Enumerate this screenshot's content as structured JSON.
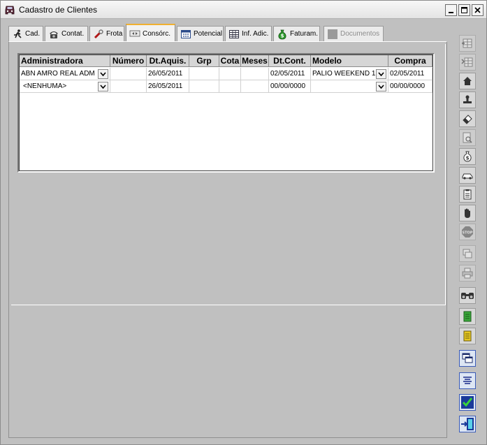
{
  "window": {
    "title": "Cadastro de Clientes"
  },
  "tabs": [
    {
      "label": "Cad.",
      "icon": "running-person-icon"
    },
    {
      "label": "Contat.",
      "icon": "telephone-icon"
    },
    {
      "label": "Frota",
      "icon": "wrench-icon"
    },
    {
      "label": "Consórc.",
      "icon": "consortium-icon",
      "active": true
    },
    {
      "label": "Potencial",
      "icon": "calendar-icon"
    },
    {
      "label": "Inf. Adic.",
      "icon": "grid-icon"
    },
    {
      "label": "Faturam.",
      "icon": "money-bag-icon"
    },
    {
      "label": "Documentos",
      "icon": "document-icon",
      "disabled": true
    }
  ],
  "grid": {
    "columns": [
      "Administradora",
      "Número",
      "Dt.Aquis.",
      "Grp",
      "Cota",
      "Meses",
      "Dt.Cont.",
      "Modelo",
      "Compra"
    ],
    "rows": [
      {
        "administradora": "ABN AMRO REAL ADM",
        "numero": "",
        "dt_aquis": "26/05/2011",
        "grp": "",
        "cota": "",
        "meses": "",
        "dt_cont": "02/05/2011",
        "modelo": "PALIO WEEKEND 1",
        "compra": "02/05/2011"
      },
      {
        "administradora": "<NENHUMA>",
        "numero": "",
        "dt_aquis": "26/05/2011",
        "grp": "",
        "cota": "",
        "meses": "",
        "dt_cont": "00/00/0000",
        "modelo": "",
        "compra": "00/00/0000"
      }
    ]
  },
  "toolbar": [
    {
      "name": "add-row-icon",
      "enabled": false
    },
    {
      "name": "insert-row-icon",
      "enabled": false
    },
    {
      "name": "home-icon",
      "enabled": true
    },
    {
      "name": "stamp-icon",
      "enabled": true
    },
    {
      "name": "eraser-icon",
      "enabled": true
    },
    {
      "name": "search-document-icon",
      "enabled": false
    },
    {
      "name": "money-bag-icon",
      "enabled": true
    },
    {
      "name": "car-icon",
      "enabled": true
    },
    {
      "name": "clipboard-icon",
      "enabled": true
    },
    {
      "name": "hand-icon",
      "enabled": true
    },
    {
      "name": "stop-icon",
      "enabled": false
    },
    {
      "name": "copy-icon",
      "enabled": false
    },
    {
      "name": "print-icon",
      "enabled": false
    },
    {
      "name": "binoculars-icon",
      "enabled": true
    },
    {
      "name": "green-doc-icon",
      "enabled": true
    },
    {
      "name": "yellow-doc-icon",
      "enabled": true
    },
    {
      "name": "windows-icon",
      "enabled": true
    },
    {
      "name": "align-center-icon",
      "enabled": true
    },
    {
      "name": "confirm-check-icon",
      "enabled": true
    },
    {
      "name": "exit-door-icon",
      "enabled": true
    }
  ]
}
